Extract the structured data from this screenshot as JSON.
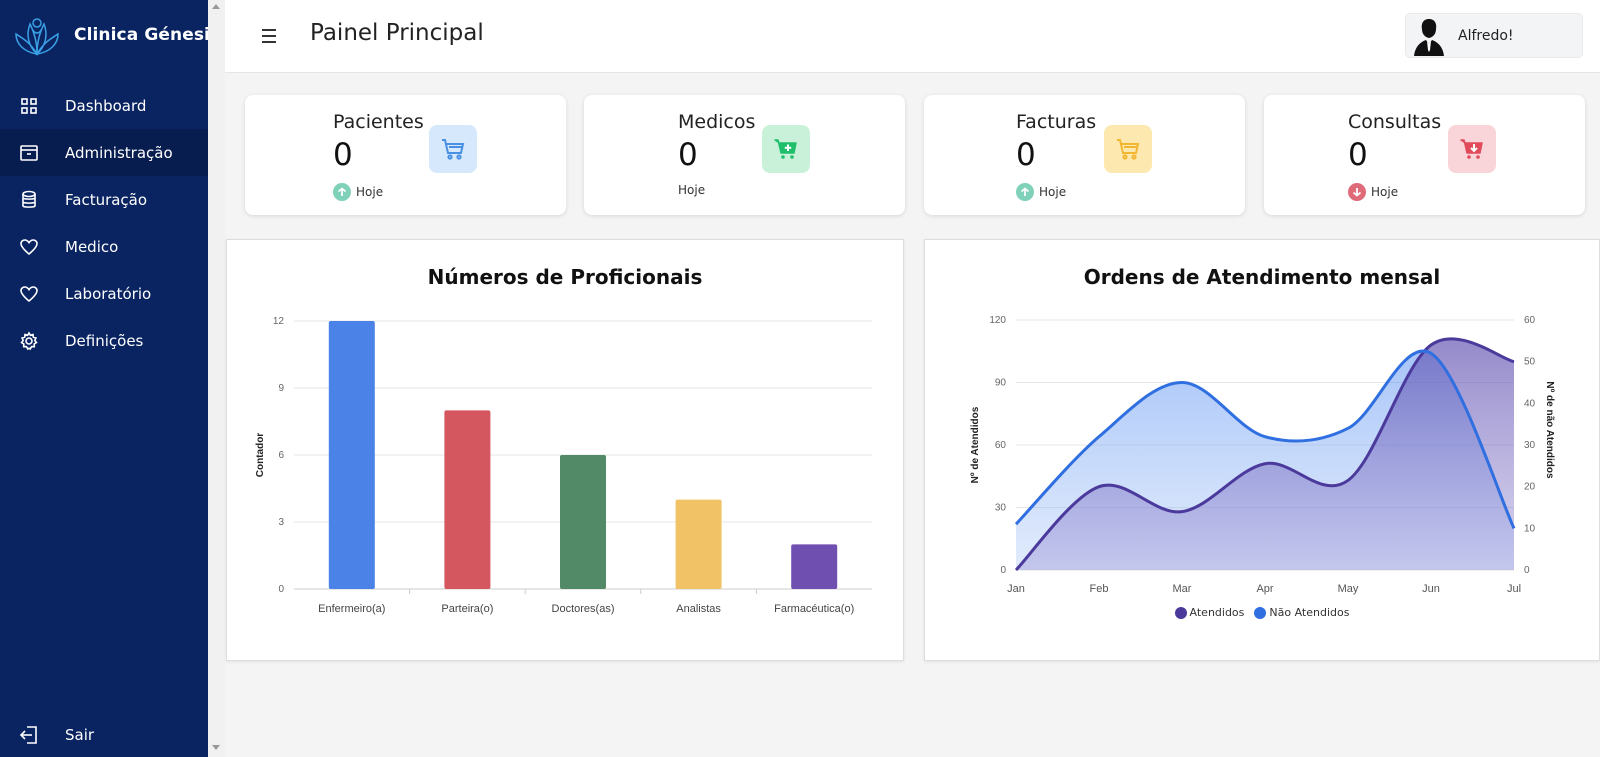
{
  "brand": {
    "name": "Clinica Génesis"
  },
  "sidebar": {
    "items": [
      {
        "label": "Dashboard",
        "icon": "grid-icon",
        "active": false
      },
      {
        "label": "Administração",
        "icon": "archive-icon",
        "active": true
      },
      {
        "label": "Facturação",
        "icon": "database-icon",
        "active": false
      },
      {
        "label": "Medico",
        "icon": "heart-icon",
        "active": false
      },
      {
        "label": "Laboratório",
        "icon": "heart-icon",
        "active": false
      },
      {
        "label": "Definições",
        "icon": "gear-icon",
        "active": false
      }
    ],
    "logout_label": "Sair"
  },
  "header": {
    "title": "Painel Principal",
    "user_name": "Alfredo!"
  },
  "cards": [
    {
      "title": "Pacientes",
      "value": "0",
      "trend_label": "Hoje",
      "trend": "up",
      "icon_color": "#4a90e2",
      "icon_bg": "#d6e8fb",
      "trend_color": "#7fd1b9"
    },
    {
      "title": "Medicos",
      "value": "0",
      "trend_label": "Hoje",
      "trend": "none",
      "icon_color": "#1fbf6b",
      "icon_bg": "#c9f1d9",
      "trend_color": ""
    },
    {
      "title": "Facturas",
      "value": "0",
      "trend_label": "Hoje",
      "trend": "up",
      "icon_color": "#f2b632",
      "icon_bg": "#fde9b0",
      "trend_color": "#7fd1b9"
    },
    {
      "title": "Consultas",
      "value": "0",
      "trend_label": "Hoje",
      "trend": "down",
      "icon_color": "#e04a5a",
      "icon_bg": "#f9d4d8",
      "trend_color": "#e06b78"
    }
  ],
  "chart_data": [
    {
      "type": "bar",
      "title": "Números de Proficionais",
      "categories": [
        "Enfermeiro(a)",
        "Parteira(o)",
        "Doctores(as)",
        "Analistas",
        "Farmacéutica(o)"
      ],
      "values": [
        12,
        8,
        6,
        4,
        2
      ],
      "colors": [
        "#4a82e8",
        "#d4575f",
        "#528a68",
        "#f2c266",
        "#6f4fb0"
      ],
      "ylabel": "Contador",
      "xlabel": "",
      "ylim": [
        0,
        12
      ],
      "yticks": [
        0,
        3,
        6,
        9,
        12
      ],
      "grid": true
    },
    {
      "type": "area",
      "title": "Ordens de Atendimento mensal",
      "categories": [
        "Jan",
        "Feb",
        "Mar",
        "Apr",
        "May",
        "Jun",
        "Jul"
      ],
      "series": [
        {
          "name": "Atendidos",
          "axis": "left",
          "values": [
            0,
            40,
            28,
            51,
            43,
            108,
            100
          ],
          "color": "#4b3a9c"
        },
        {
          "name": "Não Atendidos",
          "axis": "right",
          "values": [
            11,
            32,
            45,
            32,
            34,
            52,
            10
          ],
          "color": "#2f6fe0"
        }
      ],
      "ylabel": "Nº de Atendidos",
      "y2label": "Nº de não Atendidos",
      "ylim": [
        0,
        120
      ],
      "yticks": [
        0,
        30,
        60,
        90,
        120
      ],
      "y2lim": [
        0,
        60
      ],
      "y2ticks": [
        0,
        10,
        20,
        30,
        40,
        50,
        60
      ],
      "legend": "bottom",
      "grid": true
    }
  ]
}
